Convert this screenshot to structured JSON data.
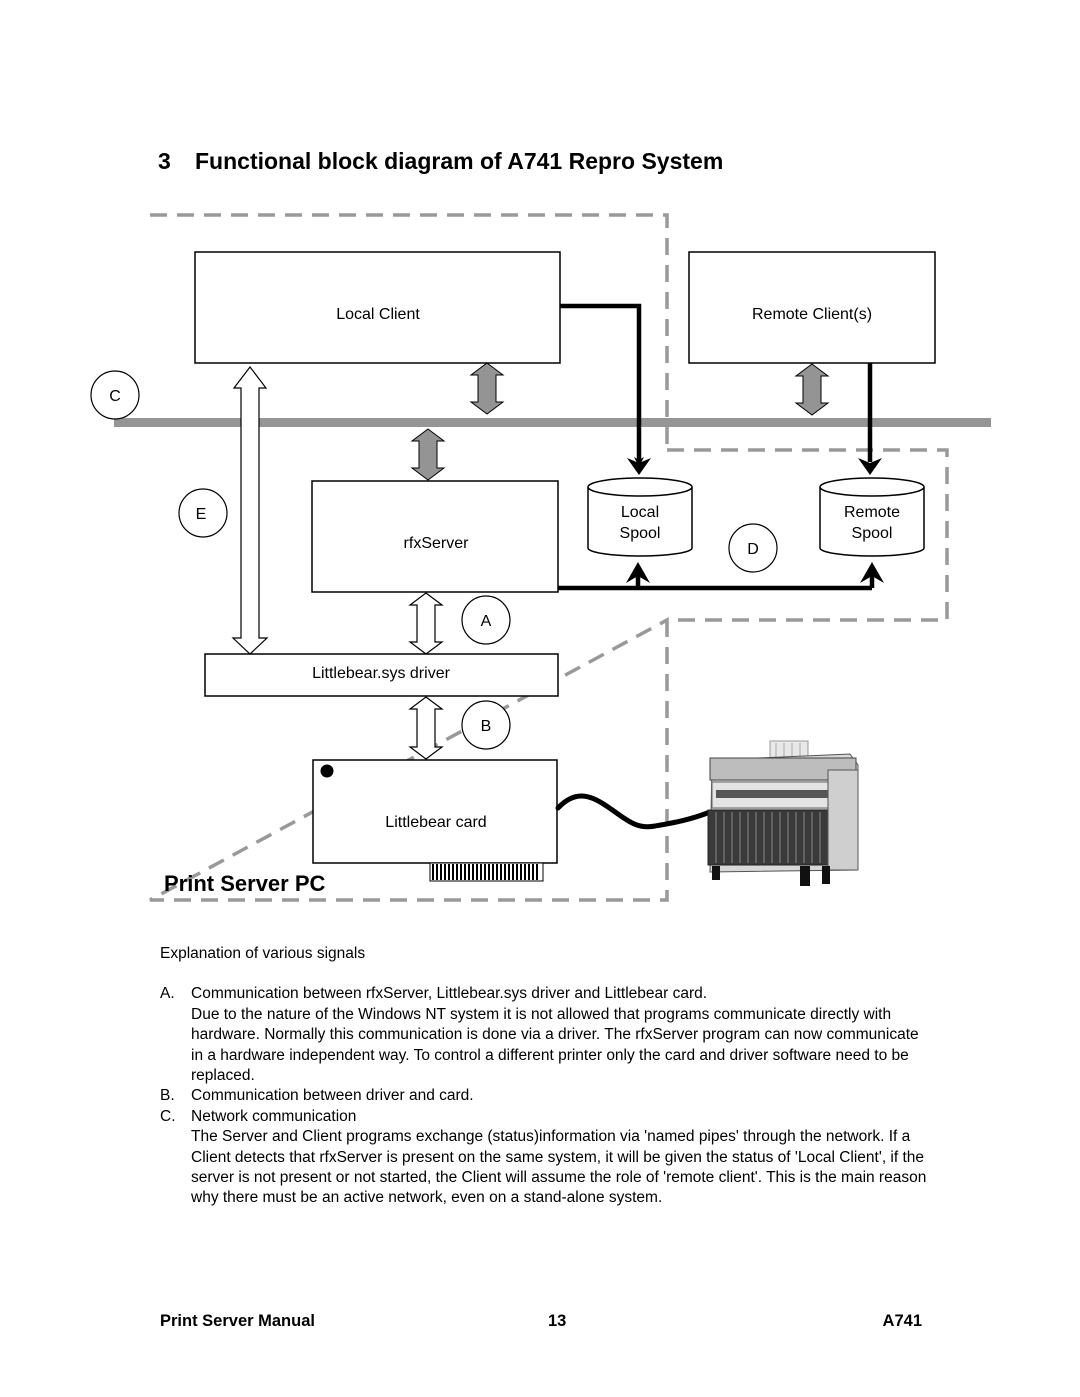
{
  "heading": {
    "number": "3",
    "title": "Functional block diagram of A741 Repro System"
  },
  "diagram": {
    "blocks": {
      "local_client": "Local Client",
      "remote_clients": "Remote Client(s)",
      "rfxserver": "rfxServer",
      "driver": "Littlebear.sys driver",
      "card": "Littlebear card",
      "local_spool": [
        "Local",
        "Spool"
      ],
      "remote_spool": [
        "Remote",
        "Spool"
      ]
    },
    "signal_labels": {
      "a": "A",
      "b": "B",
      "c": "C",
      "d": "D",
      "e": "E"
    },
    "region_label": "Print Server PC",
    "colors": {
      "network": "#959595",
      "dashed_border": "#999999",
      "gray_arrow": "#949494"
    }
  },
  "explanation": {
    "intro": "Explanation of various signals",
    "items": [
      {
        "letter": "A.",
        "title": "Communication between rfxServer, Littlebear.sys driver and Littlebear card.",
        "detail": "Due to the nature of the Windows NT system it is not allowed that programs communicate directly with hardware. Normally this communication is done via a driver. The rfxServer program can now communicate in a hardware independent way. To control a different printer only the card and driver software need to be replaced."
      },
      {
        "letter": "B.",
        "title": "Communication between driver and card.",
        "detail": ""
      },
      {
        "letter": "C.",
        "title": "Network communication",
        "detail": "The Server and Client programs exchange (status)information via 'named pipes' through the network. If a Client detects that rfxServer is present on the same system, it will be given the status of 'Local Client', if the server is not present or not started, the Client will assume the role of 'remote client'. This is the main reason why there must be an active network, even on a stand-alone system."
      }
    ]
  },
  "footer": {
    "left": "Print Server Manual",
    "page": "13",
    "right": "A741"
  }
}
